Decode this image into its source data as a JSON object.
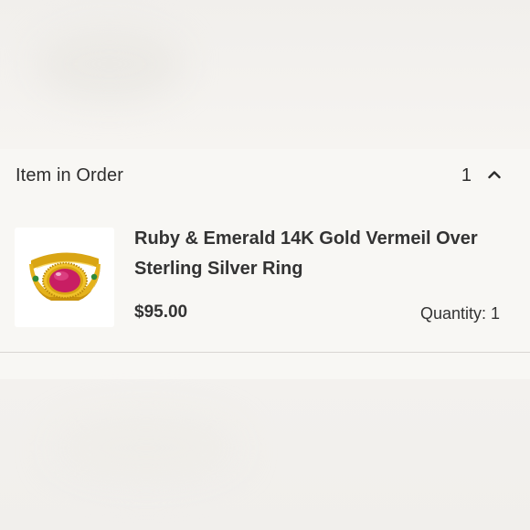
{
  "order_summary": {
    "title": "Item in Order",
    "item_count": "1",
    "toggle_icon": "chevron-up-icon"
  },
  "item": {
    "name": "Ruby & Emerald 14K Gold Vermeil Over Sterling Silver Ring",
    "price": "$95.00",
    "quantity_label": "Quantity: 1",
    "image_icon": "ring-product-image"
  },
  "colors": {
    "background": "#f5f3f0",
    "panel": "#f8f7f4",
    "text": "#2e2e2e",
    "gold": "#e8b820",
    "ruby": "#c81e63",
    "emerald": "#2f8a3a"
  }
}
